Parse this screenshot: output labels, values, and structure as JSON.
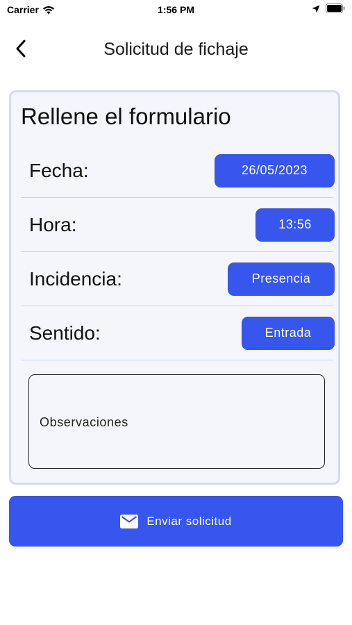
{
  "status_bar": {
    "carrier": "Carrier",
    "time": "1:56 PM"
  },
  "nav": {
    "title": "Solicitud de fichaje"
  },
  "form": {
    "heading": "Rellene el formulario",
    "rows": [
      {
        "label": "Fecha:",
        "value": "26/05/2023"
      },
      {
        "label": "Hora:",
        "value": "13:56"
      },
      {
        "label": "Incidencia:",
        "value": "Presencia"
      },
      {
        "label": "Sentido:",
        "value": "Entrada"
      }
    ],
    "observations_placeholder": "Observaciones"
  },
  "actions": {
    "send_label": "Enviar solicitud"
  },
  "colors": {
    "accent": "#3656ee",
    "card_background": "#f5f6fb",
    "card_border": "#d5daf1",
    "divider": "#c3d2f3"
  },
  "icons": {
    "status": [
      "wifi-icon",
      "location-arrow-icon",
      "battery-icon"
    ],
    "nav": "chevron-left-icon",
    "send": "mail-icon"
  }
}
